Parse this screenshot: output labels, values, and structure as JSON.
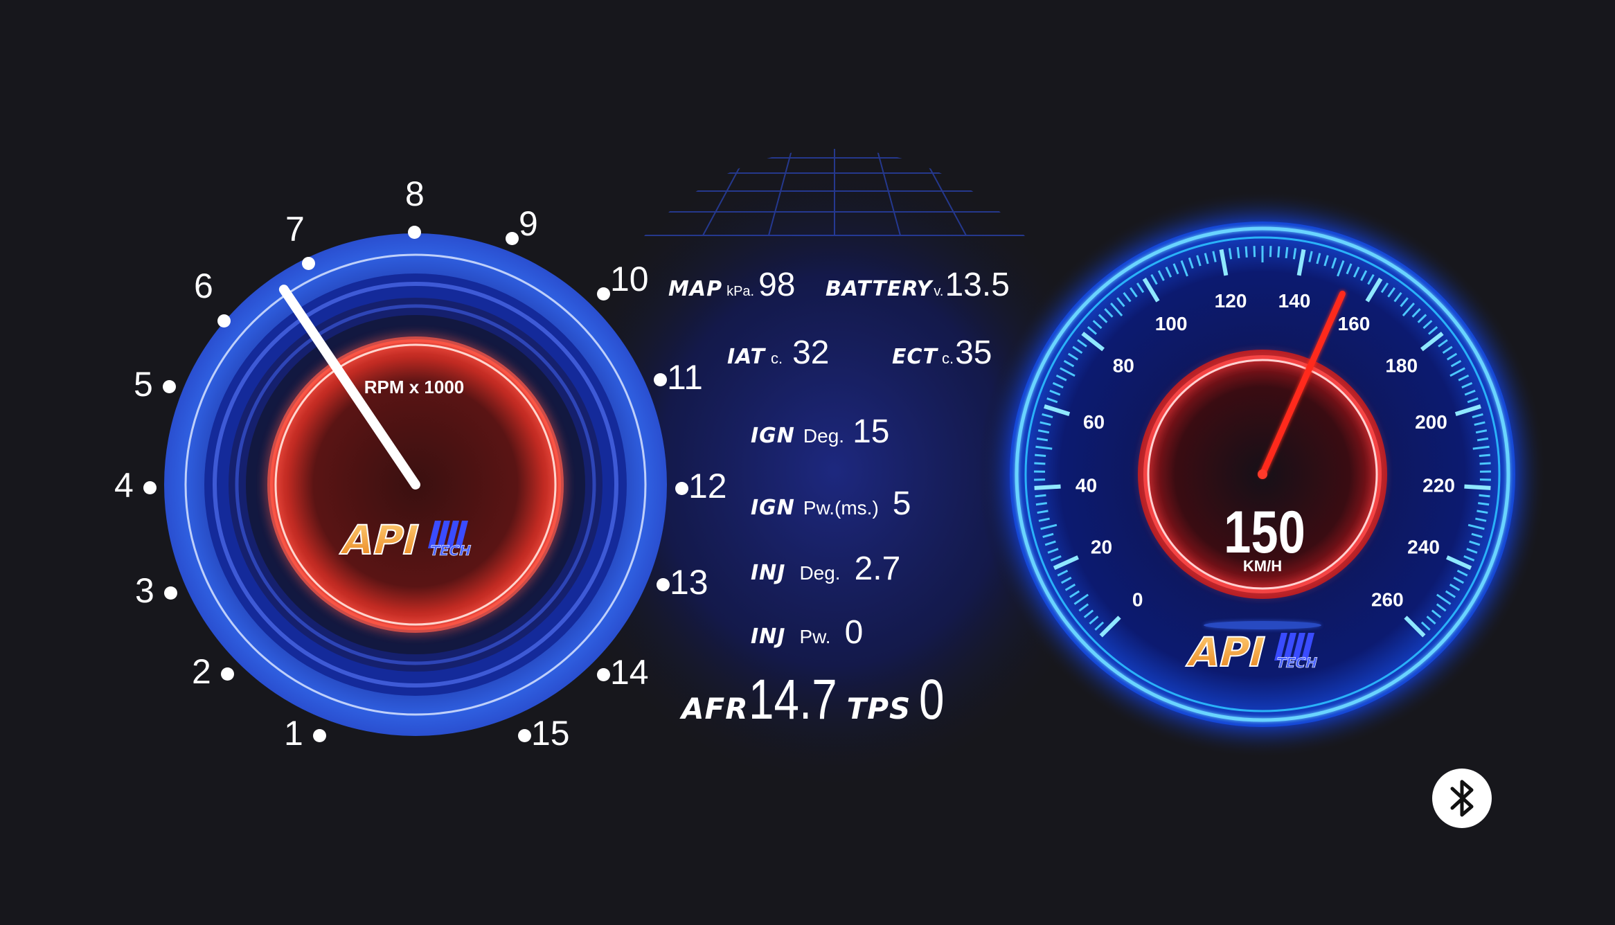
{
  "colors": {
    "background": "#17171c",
    "rpm_blue": "#2f5fe0",
    "speed_blue": "#19a8ff",
    "red_glow": "#ff3b3b",
    "logo_orange": "#f39a1e"
  },
  "tachometer": {
    "label": "RPM x 1000",
    "needle_value": 6.3,
    "tick_labels": [
      "1",
      "2",
      "3",
      "4",
      "5",
      "6",
      "7",
      "8",
      "9",
      "10",
      "11",
      "12",
      "13",
      "14",
      "15"
    ],
    "logo": {
      "main": "API",
      "sub": "TECH"
    }
  },
  "sensors": {
    "map": {
      "label": "MAP",
      "unit": "kPa.",
      "value": "98"
    },
    "battery": {
      "label": "BATTERY",
      "unit": "v.",
      "value": "13.5"
    },
    "iat": {
      "label": "IAT",
      "unit": "c.",
      "value": "32"
    },
    "ect": {
      "label": "ECT",
      "unit": "c.",
      "value": "35"
    },
    "ign_deg": {
      "label": "IGN",
      "unit": "Deg.",
      "value": "15"
    },
    "ign_pw": {
      "label": "IGN",
      "unit": "Pw.(ms.)",
      "value": "5"
    },
    "inj_deg": {
      "label": "INJ",
      "unit": "Deg.",
      "value": "2.7"
    },
    "inj_pw": {
      "label": "INJ",
      "unit": "Pw.",
      "value": "0"
    },
    "afr": {
      "label": "AFR",
      "value": "14.7"
    },
    "tps": {
      "label": "TPS",
      "value": "0"
    }
  },
  "speedometer": {
    "value": "150",
    "unit": "KM/H",
    "needle_value": 153,
    "scale_labels": [
      "0",
      "20",
      "40",
      "60",
      "80",
      "100",
      "120",
      "140",
      "160",
      "180",
      "200",
      "220",
      "240",
      "260"
    ],
    "logo": {
      "main": "API",
      "sub": "TECH"
    }
  },
  "bluetooth": {
    "icon": "bluetooth-icon"
  }
}
